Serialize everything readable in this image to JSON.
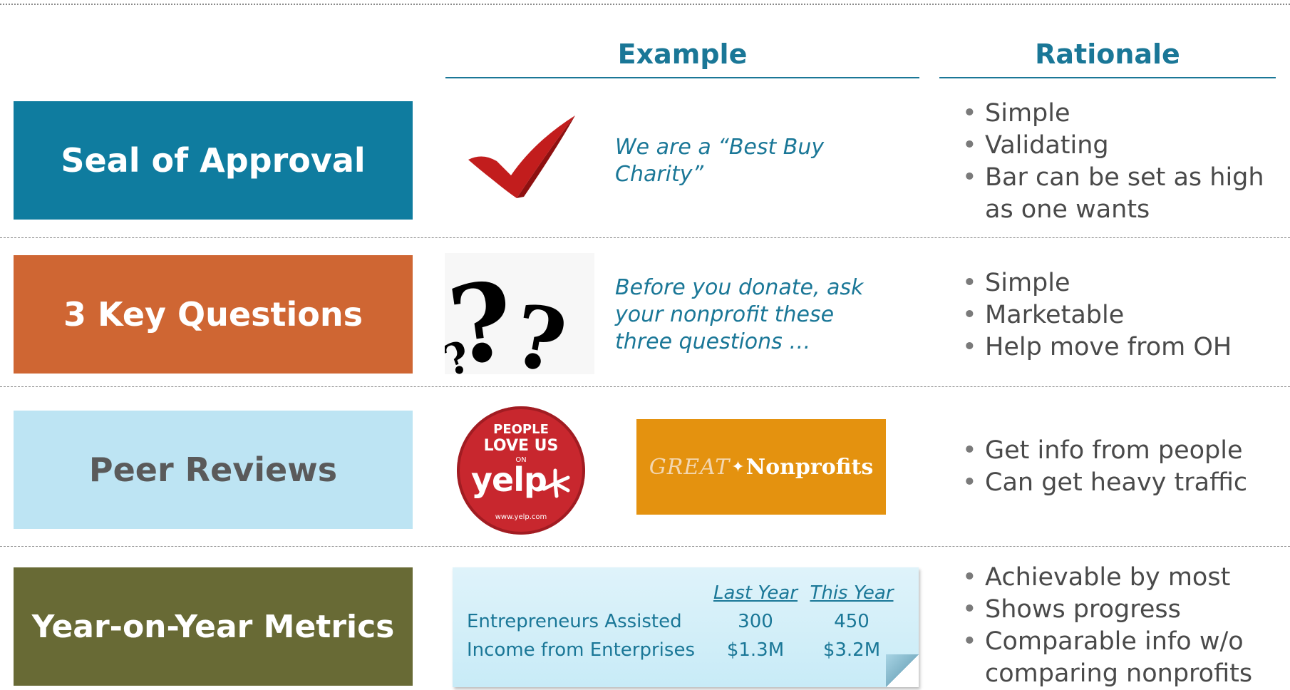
{
  "headers": {
    "example": "Example",
    "rationale": "Rationale"
  },
  "rows": [
    {
      "label": "Seal of Approval",
      "color": "#0f7c9f",
      "text_color": "#ffffff",
      "example_text": "We are a “Best Buy Charity”",
      "bullets": [
        "Simple",
        "Validating",
        "Bar can be set as high as one wants"
      ]
    },
    {
      "label": "3 Key Questions",
      "color": "#cf6633",
      "text_color": "#ffffff",
      "example_text": "Before you donate, ask your nonprofit these three questions …",
      "bullets": [
        "Simple",
        "Marketable",
        "Help move from OH"
      ]
    },
    {
      "label": "Peer Reviews",
      "color": "#bde4f3",
      "text_color": "#5a5a5a",
      "yelp_badge": {
        "line1": "PEOPLE",
        "line2": "LOVE US",
        "line3": "ON",
        "brand": "yelp",
        "url": "www.yelp.com"
      },
      "gn_logo": {
        "part1": "GREAT",
        "part2": "Nonprofits"
      },
      "bullets": [
        "Get info from people",
        "Can get heavy traffic"
      ]
    },
    {
      "label": "Year-on-Year Metrics",
      "color": "#686a35",
      "text_color": "#ffffff",
      "bullets": [
        "Achievable by most",
        "Shows progress",
        "Comparable info w/o comparing nonprofits"
      ]
    }
  ],
  "metrics": {
    "col_last": "Last Year",
    "col_this": "This Year",
    "rows": [
      {
        "label": "Entrepreneurs Assisted",
        "last": "300",
        "this": "450"
      },
      {
        "label": "Income from Enterprises",
        "last": "$1.3M",
        "this": "$3.2M"
      }
    ]
  },
  "colors": {
    "accent": "#1a7797",
    "check": "#c21d1d",
    "yelp_red": "#c8272e",
    "gn_orange": "#e4920f"
  }
}
